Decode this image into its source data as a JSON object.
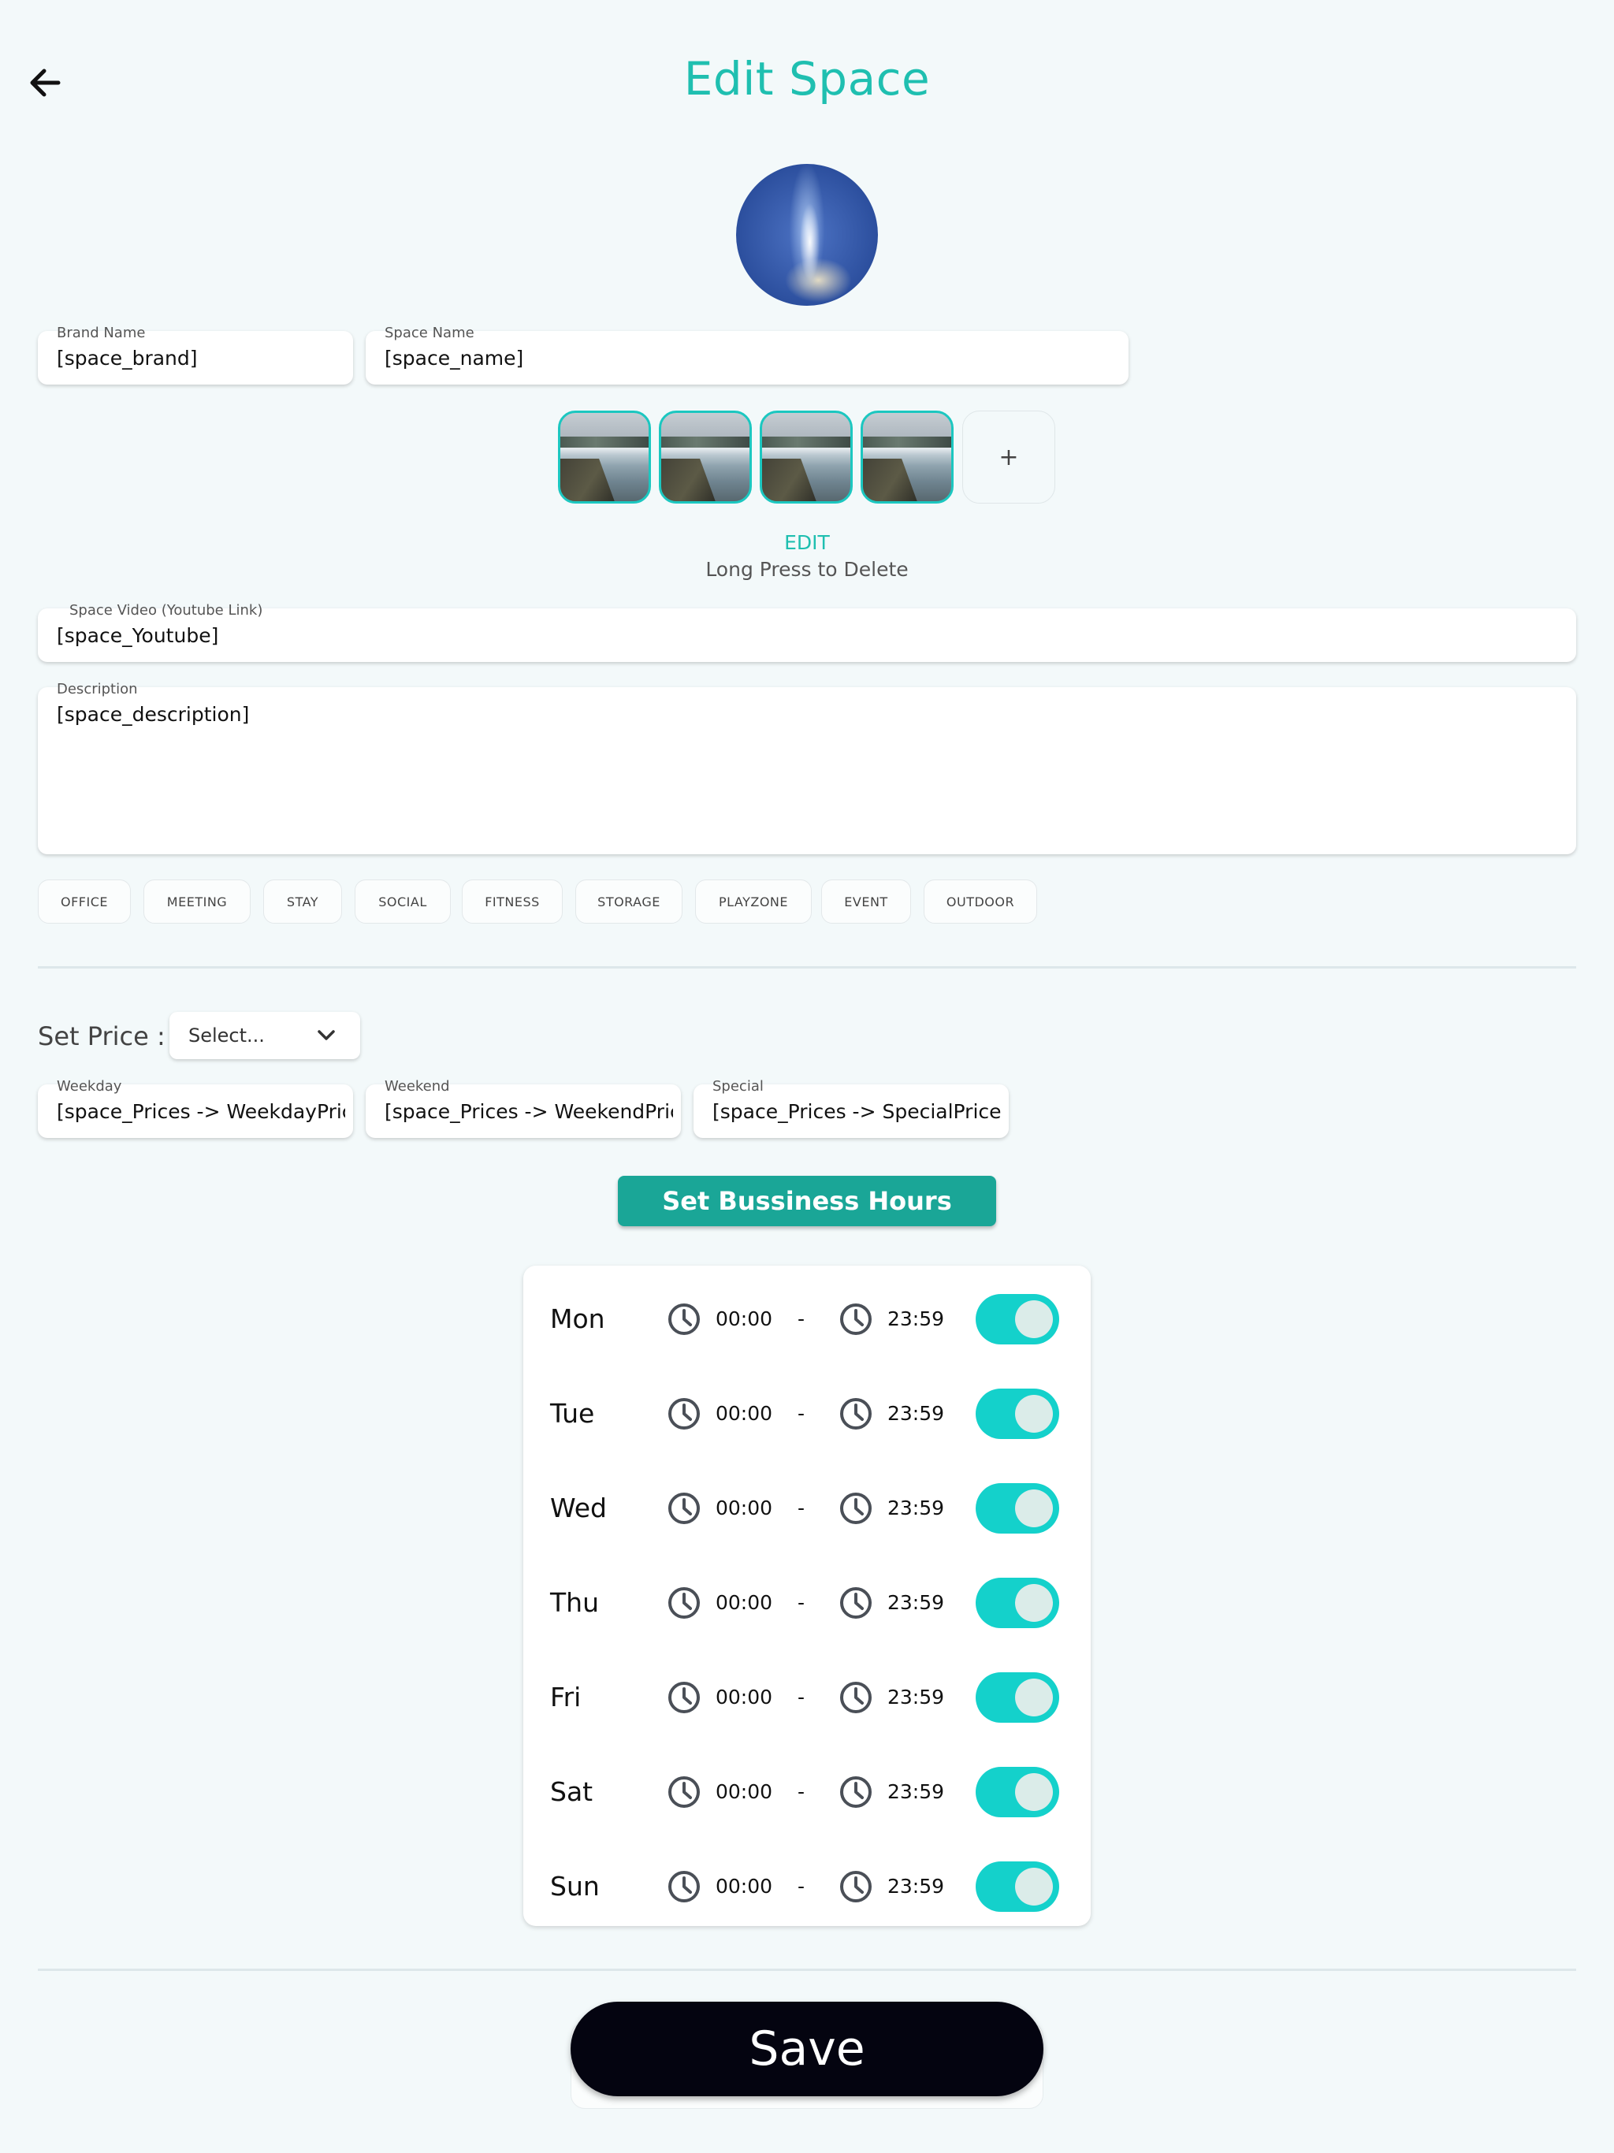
{
  "header": {
    "title": "Edit Space",
    "back_icon": "arrow-left-icon"
  },
  "colors": {
    "accent": "#1fbfb0",
    "button_teal": "#1aa697",
    "toggle_on": "#14d1cb",
    "save_bg": "#040410",
    "background": "#f3f9fa"
  },
  "form": {
    "brand": {
      "label": "Brand Name",
      "value": "[space_brand]"
    },
    "space_name": {
      "label": "Space Name",
      "value": "[space_name]"
    },
    "add_photo": "+",
    "edit_label": "EDIT",
    "delete_hint": "Long Press to Delete",
    "video": {
      "label": "Space Video (Youtube Link)",
      "value": "[space_Youtube]"
    },
    "description": {
      "label": "Description",
      "value": "[space_description]"
    }
  },
  "categories": [
    "OFFICE",
    "MEETING",
    "STAY",
    "SOCIAL",
    "FITNESS",
    "STORAGE",
    "PLAYZONE",
    "EVENT",
    "OUTDOOR"
  ],
  "pricing": {
    "label": "Set Price :",
    "select_value": "Select...",
    "weekday": {
      "label": "Weekday",
      "value": "[space_Prices -> WeekdayPric"
    },
    "weekend": {
      "label": "Weekend",
      "value": "[space_Prices -> WeekendPric"
    },
    "special": {
      "label": "Special",
      "value": "[space_Prices -> SpecialPrice]"
    }
  },
  "hours": {
    "button_label": "Set Bussiness Hours",
    "separator": "-",
    "days": [
      {
        "day": "Mon",
        "open": "00:00",
        "close": "23:59",
        "enabled": true
      },
      {
        "day": "Tue",
        "open": "00:00",
        "close": "23:59",
        "enabled": true
      },
      {
        "day": "Wed",
        "open": "00:00",
        "close": "23:59",
        "enabled": true
      },
      {
        "day": "Thu",
        "open": "00:00",
        "close": "23:59",
        "enabled": true
      },
      {
        "day": "Fri",
        "open": "00:00",
        "close": "23:59",
        "enabled": true
      },
      {
        "day": "Sat",
        "open": "00:00",
        "close": "23:59",
        "enabled": true
      },
      {
        "day": "Sun",
        "open": "00:00",
        "close": "23:59",
        "enabled": true
      }
    ]
  },
  "save_label": "Save"
}
